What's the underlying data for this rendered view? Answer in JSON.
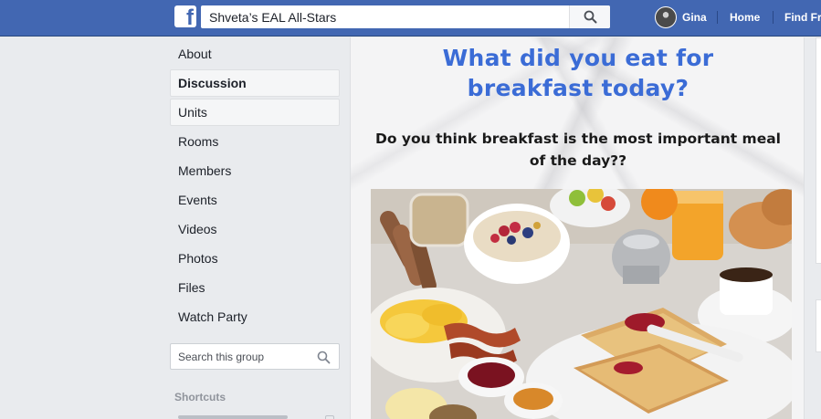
{
  "topbar": {
    "logo": "f",
    "search_value": "Shveta’s EAL All-Stars",
    "user_name": "Gina",
    "nav_home": "Home",
    "nav_find": "Find Fr"
  },
  "sidebar": {
    "items": [
      {
        "label": "About"
      },
      {
        "label": "Discussion"
      },
      {
        "label": "Units"
      },
      {
        "label": "Rooms"
      },
      {
        "label": "Members"
      },
      {
        "label": "Events"
      },
      {
        "label": "Videos"
      },
      {
        "label": "Photos"
      },
      {
        "label": "Files"
      },
      {
        "label": "Watch Party"
      }
    ],
    "search_placeholder": "Search this group",
    "shortcuts_title": "Shortcuts"
  },
  "post": {
    "headline_line1": "What did you eat for",
    "headline_line2": "breakfast today?",
    "subhead_line1": "Do you think breakfast is the most important meal",
    "subhead_line2": "of the day??"
  },
  "colors": {
    "brand": "#4267b2",
    "headline": "#3b6cd6",
    "page_bg": "#e9ebee"
  },
  "icons": {
    "logo": "facebook-logo-icon",
    "search": "search-icon",
    "group_search": "search-icon",
    "avatar": "avatar"
  }
}
